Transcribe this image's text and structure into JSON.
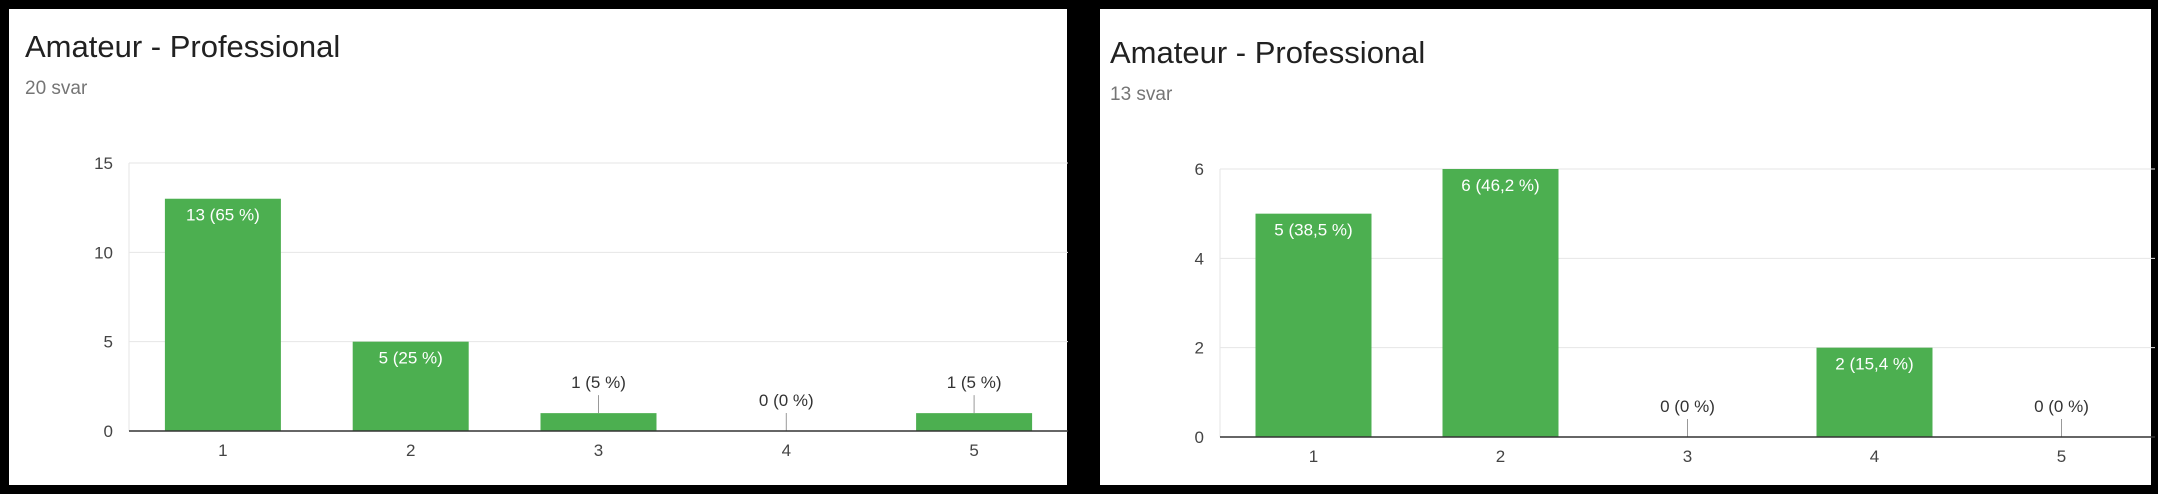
{
  "colors": {
    "bar": "#4caf50",
    "grid": "#e6e6e6",
    "axis": "#333333",
    "label_dark": "#333333",
    "label_light": "#ffffff"
  },
  "chart_data": [
    {
      "type": "bar",
      "title": "Amateur - Professional",
      "subtitle": "20 svar",
      "categories": [
        "1",
        "2",
        "3",
        "4",
        "5"
      ],
      "values": [
        13,
        5,
        1,
        0,
        1
      ],
      "data_labels": [
        "13 (65 %)",
        "5 (25 %)",
        "1 (5 %)",
        "0 (0 %)",
        "1 (5 %)"
      ],
      "ylim": [
        0,
        15
      ],
      "yticks": [
        0,
        5,
        10,
        15
      ],
      "grid": true
    },
    {
      "type": "bar",
      "title": "Amateur - Professional",
      "subtitle": "13 svar",
      "categories": [
        "1",
        "2",
        "3",
        "4",
        "5"
      ],
      "values": [
        5,
        6,
        0,
        2,
        0
      ],
      "data_labels": [
        "5 (38,5 %)",
        "6 (46,2 %)",
        "0 (0 %)",
        "2 (15,4 %)",
        "0 (0 %)"
      ],
      "ylim": [
        0,
        6
      ],
      "yticks": [
        0,
        2,
        4,
        6
      ],
      "grid": true
    }
  ]
}
